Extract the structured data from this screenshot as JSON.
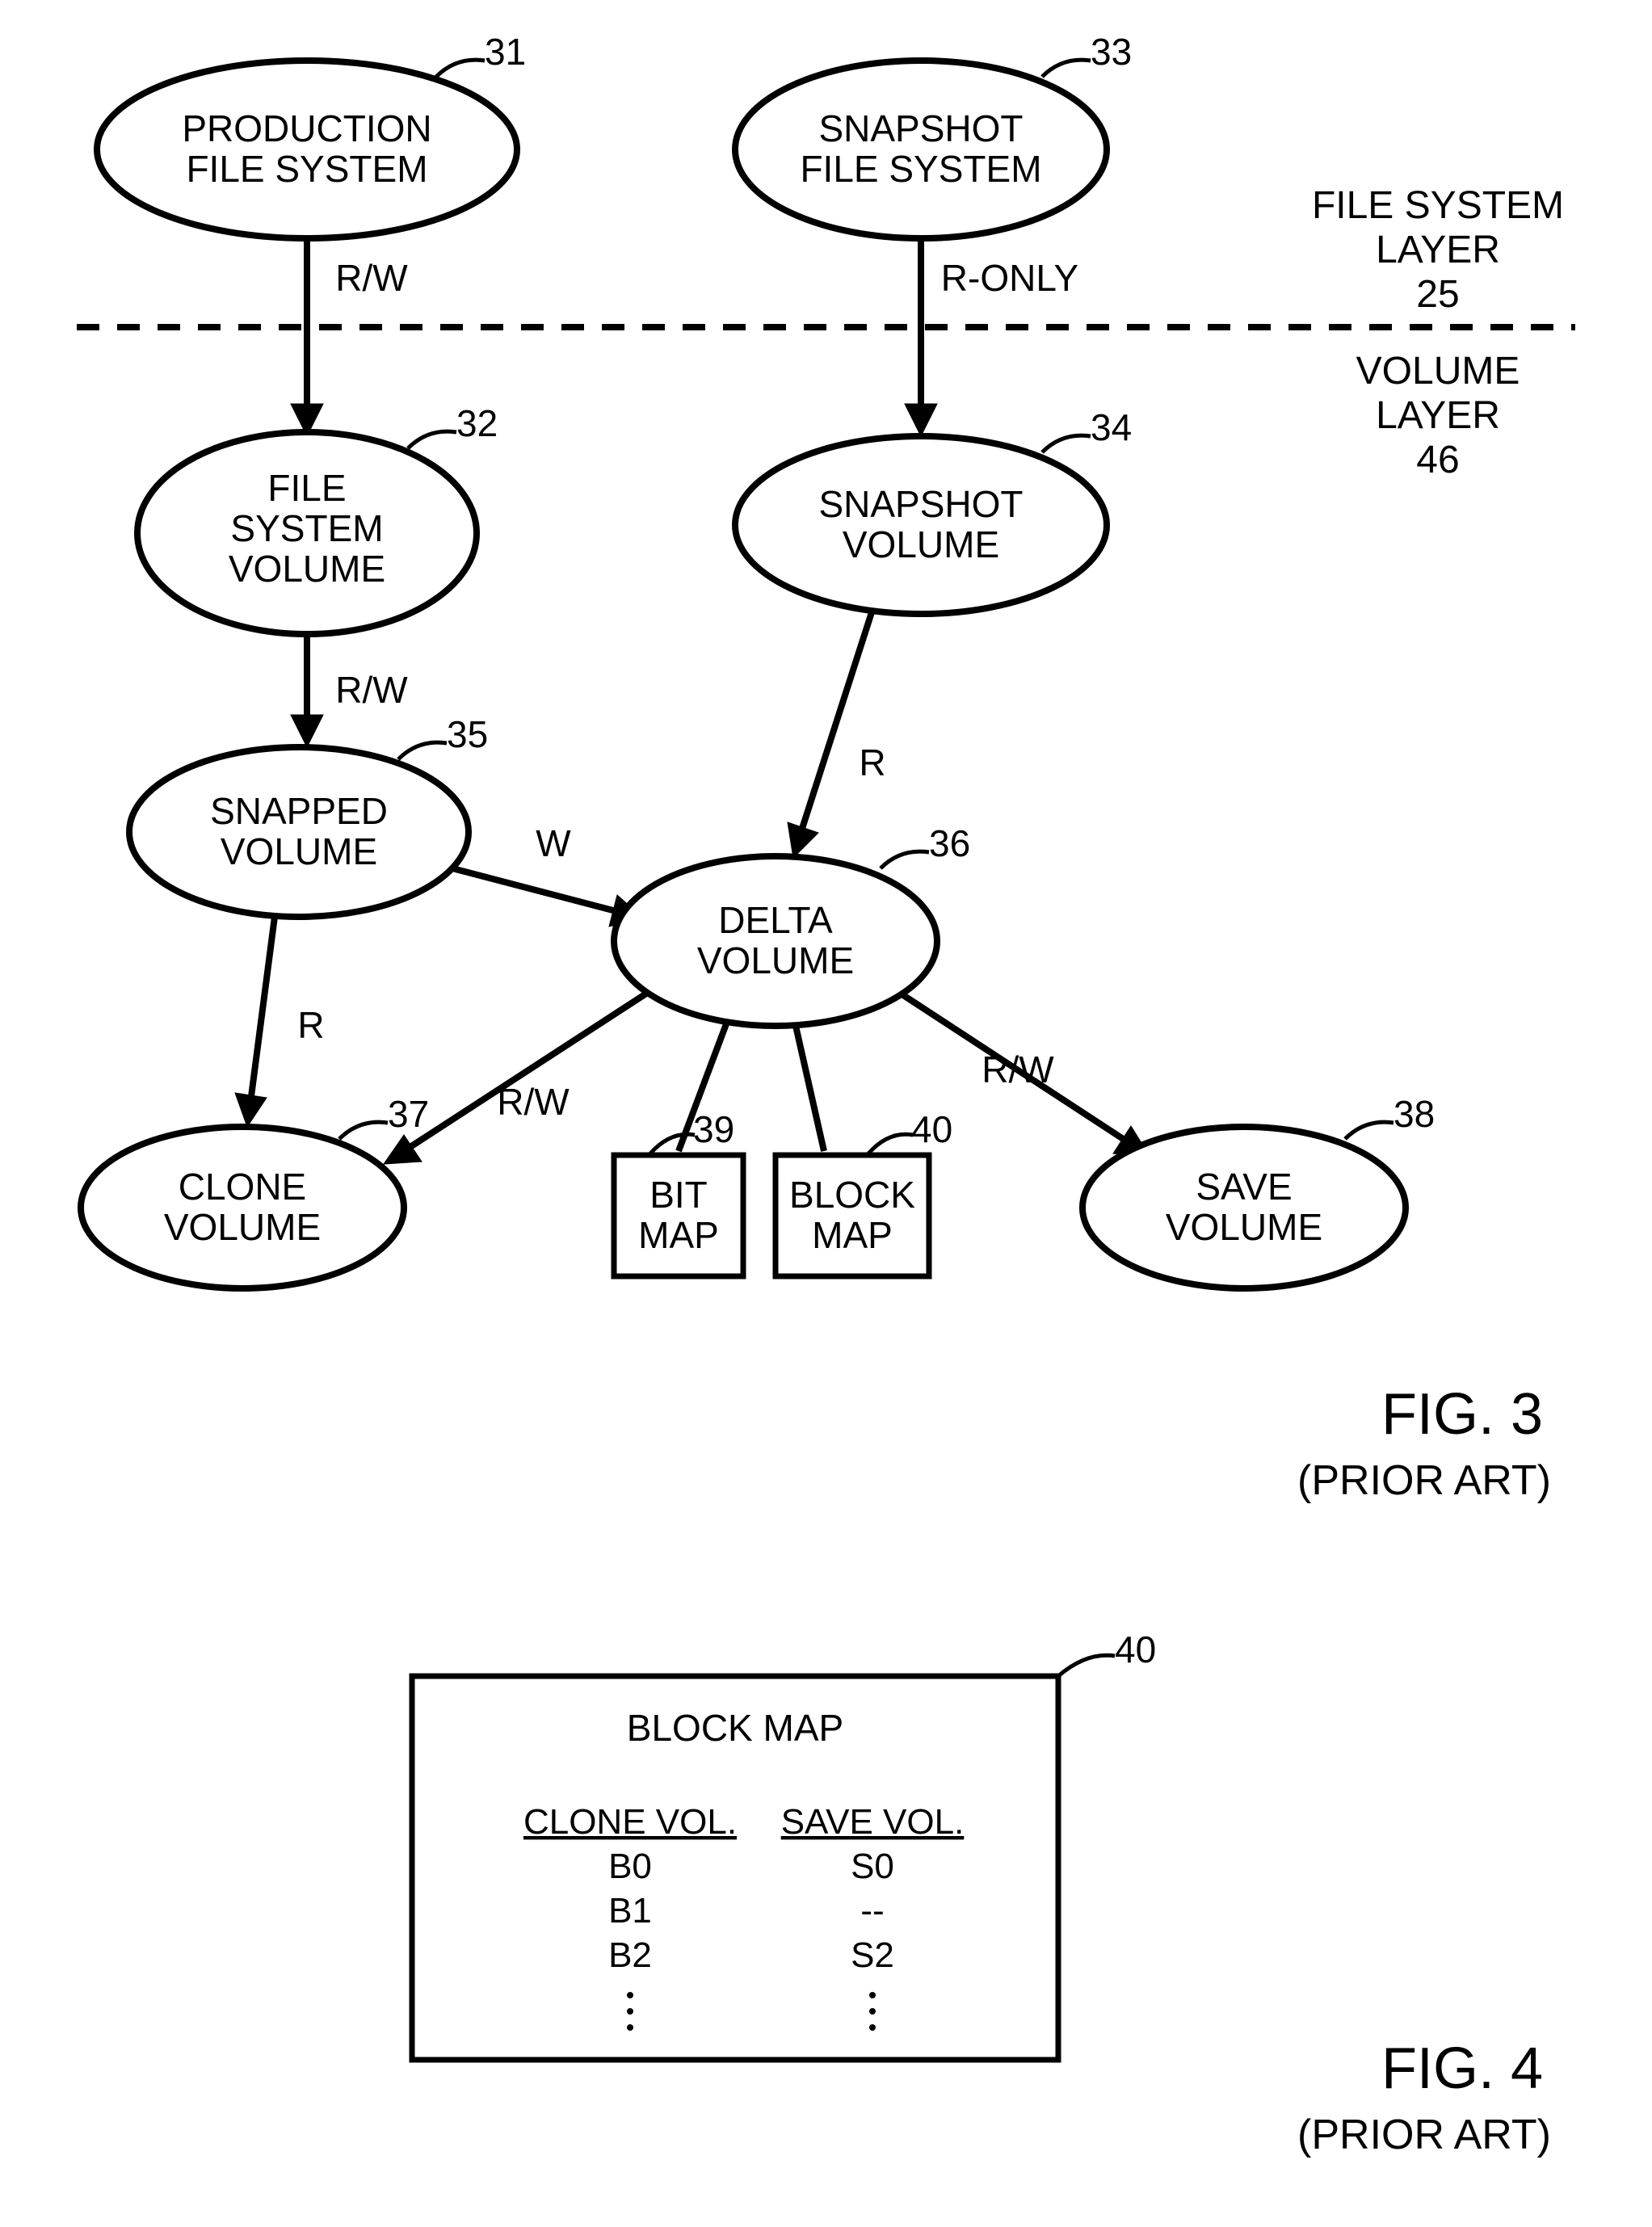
{
  "fig3": {
    "nodes": {
      "n31": {
        "num": "31",
        "l1": "PRODUCTION",
        "l2": "FILE SYSTEM"
      },
      "n33": {
        "num": "33",
        "l1": "SNAPSHOT",
        "l2": "FILE SYSTEM"
      },
      "n32": {
        "num": "32",
        "l1": "FILE",
        "l2": "SYSTEM",
        "l3": "VOLUME"
      },
      "n34": {
        "num": "34",
        "l1": "SNAPSHOT",
        "l2": "VOLUME"
      },
      "n35": {
        "num": "35",
        "l1": "SNAPPED",
        "l2": "VOLUME"
      },
      "n36": {
        "num": "36",
        "l1": "DELTA",
        "l2": "VOLUME"
      },
      "n37": {
        "num": "37",
        "l1": "CLONE",
        "l2": "VOLUME"
      },
      "n38": {
        "num": "38",
        "l1": "SAVE",
        "l2": "VOLUME"
      },
      "n39": {
        "num": "39",
        "l1": "BIT",
        "l2": "MAP"
      },
      "n40": {
        "num": "40",
        "l1": "BLOCK",
        "l2": "MAP"
      }
    },
    "edges": {
      "e31_32": "R/W",
      "e33_34": "R-ONLY",
      "e32_35": "R/W",
      "e34_36": "R",
      "e35_36": "W",
      "e35_37": "R",
      "e36_37": "R/W",
      "e36_38": "R/W"
    },
    "layers": {
      "fs": {
        "l1": "FILE SYSTEM",
        "l2": "LAYER",
        "l3": "25"
      },
      "vol": {
        "l1": "VOLUME",
        "l2": "LAYER",
        "l3": "46"
      }
    },
    "caption": {
      "l1": "FIG. 3",
      "l2": "(PRIOR ART)"
    }
  },
  "fig4": {
    "num": "40",
    "title": "BLOCK MAP",
    "col1": "CLONE VOL.",
    "col2": "SAVE VOL.",
    "rows": [
      {
        "c": "B0",
        "s": "S0"
      },
      {
        "c": "B1",
        "s": "--"
      },
      {
        "c": "B2",
        "s": "S2"
      }
    ],
    "caption": {
      "l1": "FIG. 4",
      "l2": "(PRIOR ART)"
    }
  }
}
